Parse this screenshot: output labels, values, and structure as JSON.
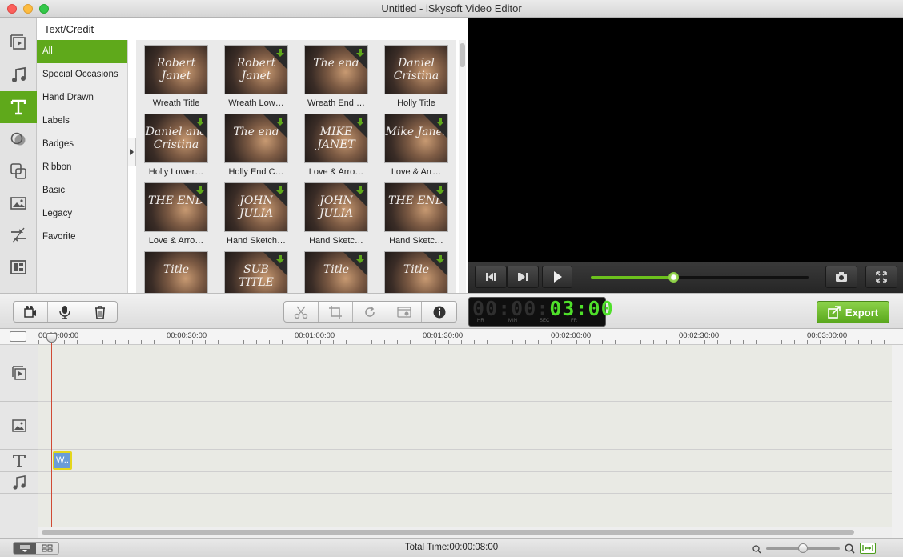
{
  "window": {
    "title": "Untitled - iSkysoft Video Editor"
  },
  "rail": {
    "items": [
      {
        "name": "media",
        "icon": "media-icon",
        "active": false
      },
      {
        "name": "music",
        "icon": "music-note-icon",
        "active": false
      },
      {
        "name": "text",
        "icon": "text-t-icon",
        "active": true
      },
      {
        "name": "filters",
        "icon": "filter-circles-icon",
        "active": false
      },
      {
        "name": "overlays",
        "icon": "overlay-squares-icon",
        "active": false
      },
      {
        "name": "elements",
        "icon": "image-icon",
        "active": false
      },
      {
        "name": "transitions",
        "icon": "transition-icon",
        "active": false
      },
      {
        "name": "split-screen",
        "icon": "split-screen-icon",
        "active": false
      }
    ]
  },
  "text_panel": {
    "heading": "Text/Credit",
    "categories": [
      {
        "label": "All",
        "active": true
      },
      {
        "label": "Special Occasions",
        "active": false
      },
      {
        "label": "Hand Drawn",
        "active": false
      },
      {
        "label": "Labels",
        "active": false
      },
      {
        "label": "Badges",
        "active": false
      },
      {
        "label": "Ribbon",
        "active": false
      },
      {
        "label": "Basic",
        "active": false
      },
      {
        "label": "Legacy",
        "active": false
      },
      {
        "label": "Favorite",
        "active": false
      }
    ],
    "thumbnails": [
      {
        "label": "Wreath Title",
        "overlay": "Robert Janet",
        "download": false
      },
      {
        "label": "Wreath Low…",
        "overlay": "Robert Janet",
        "download": true
      },
      {
        "label": "Wreath End …",
        "overlay": "The end",
        "download": true
      },
      {
        "label": "Holly Title",
        "overlay": "Daniel Cristina",
        "download": false
      },
      {
        "label": "Holly Lower…",
        "overlay": "Daniel and Cristina",
        "download": true
      },
      {
        "label": "Holly End C…",
        "overlay": "The end",
        "download": true
      },
      {
        "label": "Love & Arro…",
        "overlay": "MIKE JANET",
        "download": true
      },
      {
        "label": "Love & Arr…",
        "overlay": "Mike Janet",
        "download": true
      },
      {
        "label": "Love & Arro…",
        "overlay": "THE END",
        "download": true
      },
      {
        "label": "Hand Sketch…",
        "overlay": "JOHN JULIA",
        "download": true
      },
      {
        "label": "Hand Sketc…",
        "overlay": "JOHN JULIA",
        "download": true
      },
      {
        "label": "Hand Sketc…",
        "overlay": "THE END",
        "download": true
      },
      {
        "label": "",
        "overlay": "Title",
        "download": false
      },
      {
        "label": "",
        "overlay": "SUB TITLE",
        "download": true
      },
      {
        "label": "",
        "overlay": "Title",
        "download": true
      },
      {
        "label": "",
        "overlay": "Title",
        "download": true
      }
    ]
  },
  "player": {
    "progress": 0.38,
    "buttons": {
      "prev_frame": "step-back-icon",
      "next_frame": "step-forward-icon",
      "play": "play-icon",
      "snapshot": "camera-icon",
      "fullscreen": "fullscreen-icon"
    }
  },
  "toolbar": {
    "left_tools": [
      "record-video-icon",
      "microphone-icon",
      "trash-icon"
    ],
    "edit_tools": [
      "scissors-icon",
      "crop-icon",
      "rotate-icon",
      "settings-icon",
      "info-icon"
    ],
    "timecode": {
      "hr": "00",
      "min": "00",
      "sec": "03",
      "fr": "00",
      "unit_hr": "HR",
      "unit_min": "MIN",
      "unit_sec": "SEC",
      "unit_fr": "FR"
    },
    "export_label": "Export"
  },
  "timeline": {
    "ruler_labels": [
      "00:00:00:00",
      "00:00:30:00",
      "00:01:00:00",
      "00:01:30:00",
      "00:02:00:00",
      "00:02:30:00",
      "00:03:00:00"
    ],
    "tracks": [
      "video-track-icon",
      "image-track-icon",
      "text-track-icon",
      "music-track-icon"
    ],
    "clip_label": "W.."
  },
  "status": {
    "total_time": "Total Time:00:00:08:00",
    "zoom": 0.5
  },
  "colors": {
    "accent": "#5fa91b",
    "timecode": "#4fe02a",
    "playhead": "#d04a34",
    "clip": "#6a9cd7"
  }
}
